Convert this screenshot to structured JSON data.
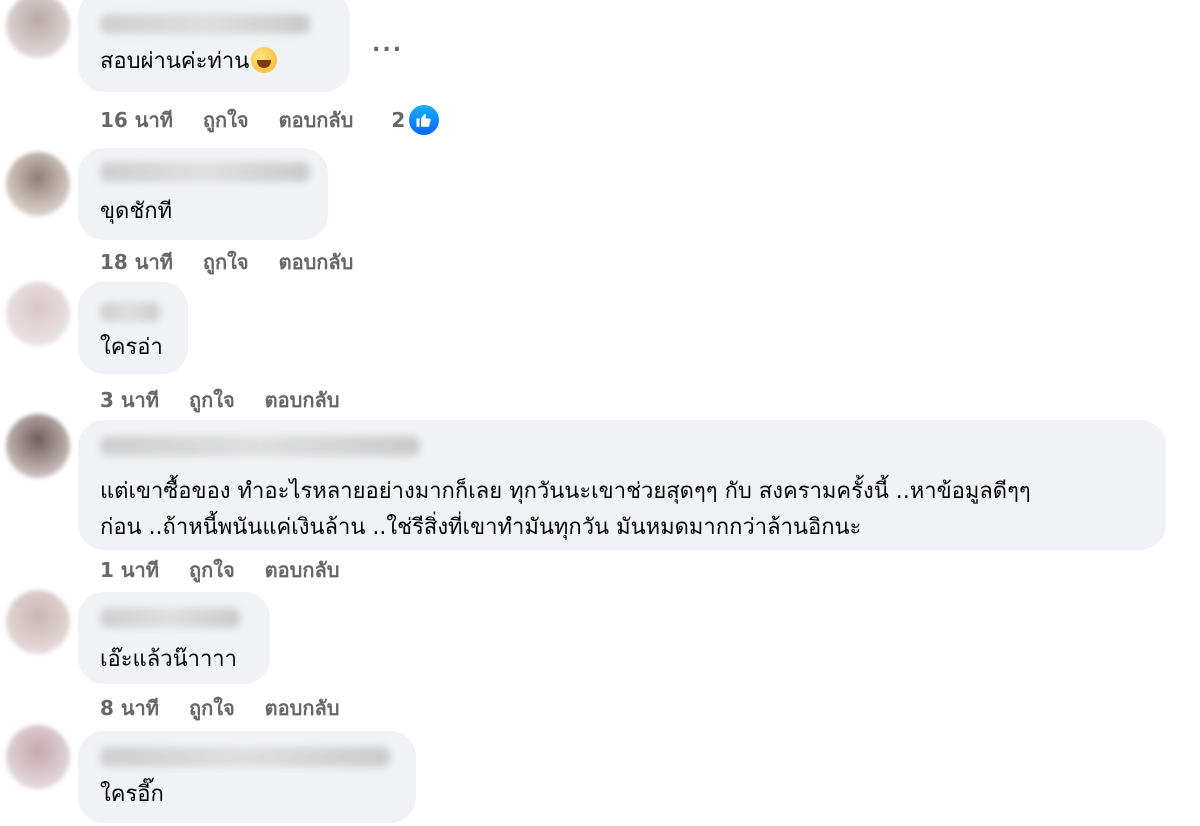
{
  "comments": [
    {
      "text": "สอบผ่านค่ะท่าน",
      "time": "16 นาที",
      "like": "ถูกใจ",
      "reply": "ตอบกลับ",
      "reactions": "2",
      "reaction_icon": "like-thumb-icon",
      "more": "..."
    },
    {
      "text": "ขุดชักที",
      "time": "18 นาที",
      "like": "ถูกใจ",
      "reply": "ตอบกลับ"
    },
    {
      "text": "ใครอ่า",
      "time": "3 นาที",
      "like": "ถูกใจ",
      "reply": "ตอบกลับ"
    },
    {
      "text_line1": "แต่เขาซื้อของ ทำอะไรหลายอย่างมากก็เลย ทุกวันนะเขาช่วยสุดๆๆ กับ สงครามครั้งนี้ ..หาข้อมูลดีๆๆ",
      "text_line2": "ก่อน ..ถ้าหนี้พนันแค่เงินล้าน ..ใช่รีสิ่งที่เขาทำมันทุกวัน มันหมดมากกว่าล้านอิกนะ",
      "time": "1 นาที",
      "like": "ถูกใจ",
      "reply": "ตอบกลับ"
    },
    {
      "text": "เอ๊ะแล้วน๊าาาา",
      "time": "8 นาที",
      "like": "ถูกใจ",
      "reply": "ตอบกลับ"
    },
    {
      "text": "ใครอี๊ก"
    }
  ],
  "colors": {
    "bubble": "#f0f2f5",
    "meta": "#65676b",
    "like_blue": "#0866ff"
  }
}
